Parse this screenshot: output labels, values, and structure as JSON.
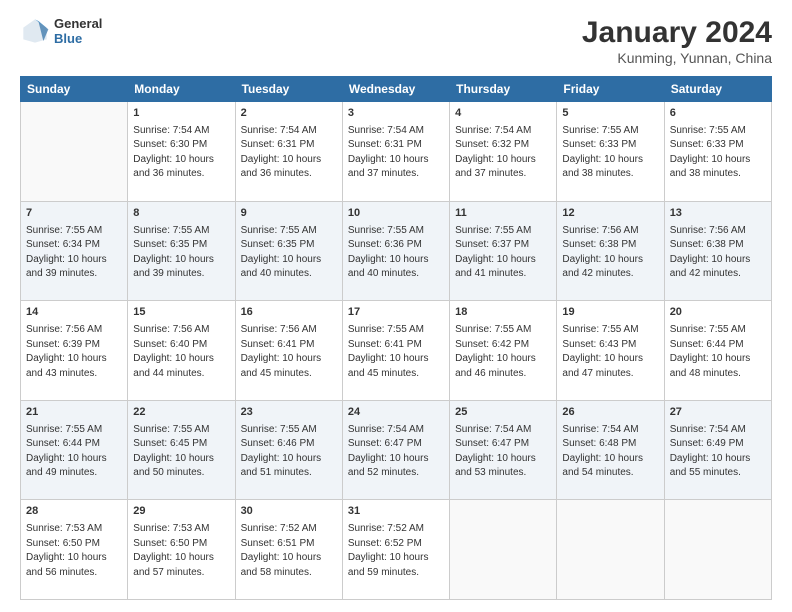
{
  "logo": {
    "general": "General",
    "blue": "Blue"
  },
  "header": {
    "title": "January 2024",
    "subtitle": "Kunming, Yunnan, China"
  },
  "days_of_week": [
    "Sunday",
    "Monday",
    "Tuesday",
    "Wednesday",
    "Thursday",
    "Friday",
    "Saturday"
  ],
  "weeks": [
    [
      {
        "day": "",
        "sunrise": "",
        "sunset": "",
        "daylight": ""
      },
      {
        "day": "1",
        "sunrise": "Sunrise: 7:54 AM",
        "sunset": "Sunset: 6:30 PM",
        "daylight": "Daylight: 10 hours and 36 minutes."
      },
      {
        "day": "2",
        "sunrise": "Sunrise: 7:54 AM",
        "sunset": "Sunset: 6:31 PM",
        "daylight": "Daylight: 10 hours and 36 minutes."
      },
      {
        "day": "3",
        "sunrise": "Sunrise: 7:54 AM",
        "sunset": "Sunset: 6:31 PM",
        "daylight": "Daylight: 10 hours and 37 minutes."
      },
      {
        "day": "4",
        "sunrise": "Sunrise: 7:54 AM",
        "sunset": "Sunset: 6:32 PM",
        "daylight": "Daylight: 10 hours and 37 minutes."
      },
      {
        "day": "5",
        "sunrise": "Sunrise: 7:55 AM",
        "sunset": "Sunset: 6:33 PM",
        "daylight": "Daylight: 10 hours and 38 minutes."
      },
      {
        "day": "6",
        "sunrise": "Sunrise: 7:55 AM",
        "sunset": "Sunset: 6:33 PM",
        "daylight": "Daylight: 10 hours and 38 minutes."
      }
    ],
    [
      {
        "day": "7",
        "sunrise": "Sunrise: 7:55 AM",
        "sunset": "Sunset: 6:34 PM",
        "daylight": "Daylight: 10 hours and 39 minutes."
      },
      {
        "day": "8",
        "sunrise": "Sunrise: 7:55 AM",
        "sunset": "Sunset: 6:35 PM",
        "daylight": "Daylight: 10 hours and 39 minutes."
      },
      {
        "day": "9",
        "sunrise": "Sunrise: 7:55 AM",
        "sunset": "Sunset: 6:35 PM",
        "daylight": "Daylight: 10 hours and 40 minutes."
      },
      {
        "day": "10",
        "sunrise": "Sunrise: 7:55 AM",
        "sunset": "Sunset: 6:36 PM",
        "daylight": "Daylight: 10 hours and 40 minutes."
      },
      {
        "day": "11",
        "sunrise": "Sunrise: 7:55 AM",
        "sunset": "Sunset: 6:37 PM",
        "daylight": "Daylight: 10 hours and 41 minutes."
      },
      {
        "day": "12",
        "sunrise": "Sunrise: 7:56 AM",
        "sunset": "Sunset: 6:38 PM",
        "daylight": "Daylight: 10 hours and 42 minutes."
      },
      {
        "day": "13",
        "sunrise": "Sunrise: 7:56 AM",
        "sunset": "Sunset: 6:38 PM",
        "daylight": "Daylight: 10 hours and 42 minutes."
      }
    ],
    [
      {
        "day": "14",
        "sunrise": "Sunrise: 7:56 AM",
        "sunset": "Sunset: 6:39 PM",
        "daylight": "Daylight: 10 hours and 43 minutes."
      },
      {
        "day": "15",
        "sunrise": "Sunrise: 7:56 AM",
        "sunset": "Sunset: 6:40 PM",
        "daylight": "Daylight: 10 hours and 44 minutes."
      },
      {
        "day": "16",
        "sunrise": "Sunrise: 7:56 AM",
        "sunset": "Sunset: 6:41 PM",
        "daylight": "Daylight: 10 hours and 45 minutes."
      },
      {
        "day": "17",
        "sunrise": "Sunrise: 7:55 AM",
        "sunset": "Sunset: 6:41 PM",
        "daylight": "Daylight: 10 hours and 45 minutes."
      },
      {
        "day": "18",
        "sunrise": "Sunrise: 7:55 AM",
        "sunset": "Sunset: 6:42 PM",
        "daylight": "Daylight: 10 hours and 46 minutes."
      },
      {
        "day": "19",
        "sunrise": "Sunrise: 7:55 AM",
        "sunset": "Sunset: 6:43 PM",
        "daylight": "Daylight: 10 hours and 47 minutes."
      },
      {
        "day": "20",
        "sunrise": "Sunrise: 7:55 AM",
        "sunset": "Sunset: 6:44 PM",
        "daylight": "Daylight: 10 hours and 48 minutes."
      }
    ],
    [
      {
        "day": "21",
        "sunrise": "Sunrise: 7:55 AM",
        "sunset": "Sunset: 6:44 PM",
        "daylight": "Daylight: 10 hours and 49 minutes."
      },
      {
        "day": "22",
        "sunrise": "Sunrise: 7:55 AM",
        "sunset": "Sunset: 6:45 PM",
        "daylight": "Daylight: 10 hours and 50 minutes."
      },
      {
        "day": "23",
        "sunrise": "Sunrise: 7:55 AM",
        "sunset": "Sunset: 6:46 PM",
        "daylight": "Daylight: 10 hours and 51 minutes."
      },
      {
        "day": "24",
        "sunrise": "Sunrise: 7:54 AM",
        "sunset": "Sunset: 6:47 PM",
        "daylight": "Daylight: 10 hours and 52 minutes."
      },
      {
        "day": "25",
        "sunrise": "Sunrise: 7:54 AM",
        "sunset": "Sunset: 6:47 PM",
        "daylight": "Daylight: 10 hours and 53 minutes."
      },
      {
        "day": "26",
        "sunrise": "Sunrise: 7:54 AM",
        "sunset": "Sunset: 6:48 PM",
        "daylight": "Daylight: 10 hours and 54 minutes."
      },
      {
        "day": "27",
        "sunrise": "Sunrise: 7:54 AM",
        "sunset": "Sunset: 6:49 PM",
        "daylight": "Daylight: 10 hours and 55 minutes."
      }
    ],
    [
      {
        "day": "28",
        "sunrise": "Sunrise: 7:53 AM",
        "sunset": "Sunset: 6:50 PM",
        "daylight": "Daylight: 10 hours and 56 minutes."
      },
      {
        "day": "29",
        "sunrise": "Sunrise: 7:53 AM",
        "sunset": "Sunset: 6:50 PM",
        "daylight": "Daylight: 10 hours and 57 minutes."
      },
      {
        "day": "30",
        "sunrise": "Sunrise: 7:52 AM",
        "sunset": "Sunset: 6:51 PM",
        "daylight": "Daylight: 10 hours and 58 minutes."
      },
      {
        "day": "31",
        "sunrise": "Sunrise: 7:52 AM",
        "sunset": "Sunset: 6:52 PM",
        "daylight": "Daylight: 10 hours and 59 minutes."
      },
      {
        "day": "",
        "sunrise": "",
        "sunset": "",
        "daylight": ""
      },
      {
        "day": "",
        "sunrise": "",
        "sunset": "",
        "daylight": ""
      },
      {
        "day": "",
        "sunrise": "",
        "sunset": "",
        "daylight": ""
      }
    ]
  ]
}
